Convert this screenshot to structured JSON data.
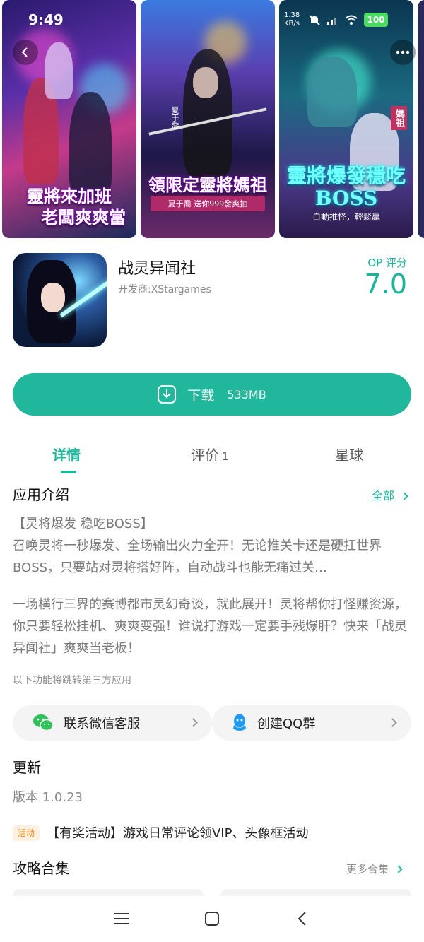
{
  "status": {
    "time": "9:49",
    "net_speed": "1.38",
    "net_unit": "KB/s",
    "battery": "100"
  },
  "screenshots": [
    {
      "banner_line1": "靈將來加班",
      "banner_line2": "老闆爽爽當"
    },
    {
      "banner": "領限定靈將媽祖",
      "sub": "夏于喬 送你999發爽抽",
      "tag": "夏于喬"
    },
    {
      "banner": "靈將爆發穩吃BOSS",
      "sub": "自動推怪，輕鬆贏",
      "tag": "媽祖"
    }
  ],
  "app": {
    "name": "战灵异闻社",
    "developer": "开发商:XStargames",
    "score_label": "OP 评分",
    "score": "7.0"
  },
  "download": {
    "label": "下载",
    "size": "533MB"
  },
  "tabs": [
    {
      "label": "详情",
      "count": ""
    },
    {
      "label": "评价",
      "count": "1"
    },
    {
      "label": "星球",
      "count": ""
    }
  ],
  "intro": {
    "title": "应用介绍",
    "all_label": "全部",
    "p1": "【灵将爆发 稳吃BOSS】",
    "p2": "召唤灵将一秒爆发、全场输出火力全开！无论推关卡还是硬扛世界BOSS，只要站对灵将搭好阵，自动战斗也能无痛过关…",
    "p3": "一场横行三界的赛博都市灵幻奇谈，就此展开！灵将帮你打怪赚资源，你只要轻松挂机、爽爽变强！谁说打游戏一定要手残爆肝？快来「战灵异闻社」爽爽当老板！",
    "note": "以下功能将跳转第三方应用"
  },
  "contacts": {
    "wechat": "联系微信客服",
    "qq": "创建QQ群"
  },
  "update": {
    "title": "更新",
    "version": "版本 1.0.23"
  },
  "event": {
    "tag": "活动",
    "text": "【有奖活动】游戏日常评论领VIP、头像框活动"
  },
  "guides": {
    "title": "攻略合集",
    "more": "更多合集"
  },
  "colors": {
    "accent": "#20b79c",
    "event_tag": "#f08a1e"
  },
  "icons": [
    "back-icon",
    "more-icon",
    "download-icon",
    "wechat-icon",
    "qq-icon",
    "menu-icon",
    "home-icon",
    "nav-back-icon"
  ]
}
